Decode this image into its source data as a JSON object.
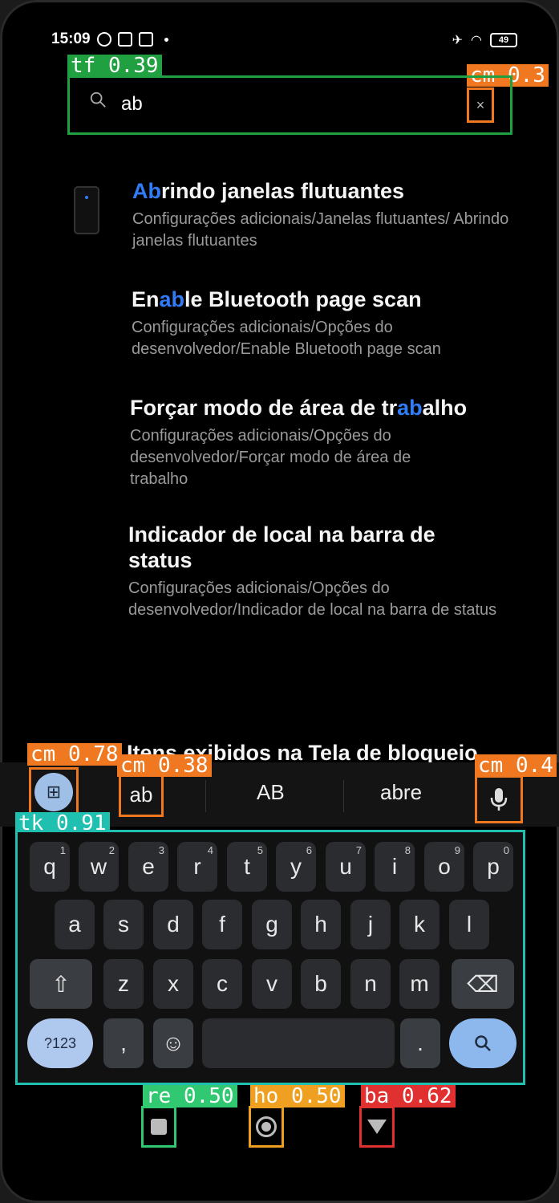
{
  "status_bar": {
    "time": "15:09",
    "battery": "49"
  },
  "search": {
    "value": "ab",
    "clear_glyph": "×"
  },
  "results": [
    {
      "title_pre": "",
      "title_hl": "Ab",
      "title_post": "rindo janelas flutuantes",
      "path": "Configurações adicionais/Janelas flutuantes/ Abrindo janelas flutuantes"
    },
    {
      "title_pre": "En",
      "title_hl": "ab",
      "title_post": "le Bluetooth page scan",
      "path": "Configurações adicionais/Opções do desenvolvedor/Enable Bluetooth page scan"
    },
    {
      "title_pre": "Forçar modo de área de tr",
      "title_hl": "ab",
      "title_post": "alho",
      "path": "Configurações adicionais/Opções do desenvolvedor/Forçar modo de área de trabalho"
    },
    {
      "title_pre": "Indicador de local na barra de status",
      "title_hl": "",
      "title_post": "",
      "path": "Configurações adicionais/Opções do desenvolvedor/Indicador de local na barra de status"
    },
    {
      "title_pre": "Itens exibidos na Tela de bloqueio",
      "title_hl": "",
      "title_post": "",
      "path": ""
    }
  ],
  "suggestions": [
    "ab",
    "AB",
    "abre"
  ],
  "keyboard": {
    "row1": [
      [
        "q",
        "1"
      ],
      [
        "w",
        "2"
      ],
      [
        "e",
        "3"
      ],
      [
        "r",
        "4"
      ],
      [
        "t",
        "5"
      ],
      [
        "y",
        "6"
      ],
      [
        "u",
        "7"
      ],
      [
        "i",
        "8"
      ],
      [
        "o",
        "9"
      ],
      [
        "p",
        "0"
      ]
    ],
    "row2": [
      "a",
      "s",
      "d",
      "f",
      "g",
      "h",
      "j",
      "k",
      "l"
    ],
    "row3": [
      "z",
      "x",
      "c",
      "v",
      "b",
      "n",
      "m"
    ],
    "symbols_label": "?123",
    "comma": ",",
    "period": ".",
    "emoji": "☺",
    "shift": "⇧",
    "backspace": "⌫",
    "search": "⚲"
  },
  "detections": {
    "tf": "tf 0.39",
    "cm_clear": "cm 0.3",
    "cm_apps": "cm 0.78",
    "cm_ab": "cm 0.38",
    "cm_mic": "cm 0.4",
    "tk": "tk 0.91",
    "re": "re 0.50",
    "ho": "ho 0.50",
    "ba": "ba 0.62"
  },
  "icons": {
    "search": "search-icon",
    "clear": "close-icon",
    "apps": "grid-icon",
    "mic": "microphone-icon",
    "recent": "recent-apps-icon",
    "home": "home-icon",
    "back": "back-icon"
  },
  "colors": {
    "highlight": "#2f7cf6",
    "background": "#000000"
  }
}
